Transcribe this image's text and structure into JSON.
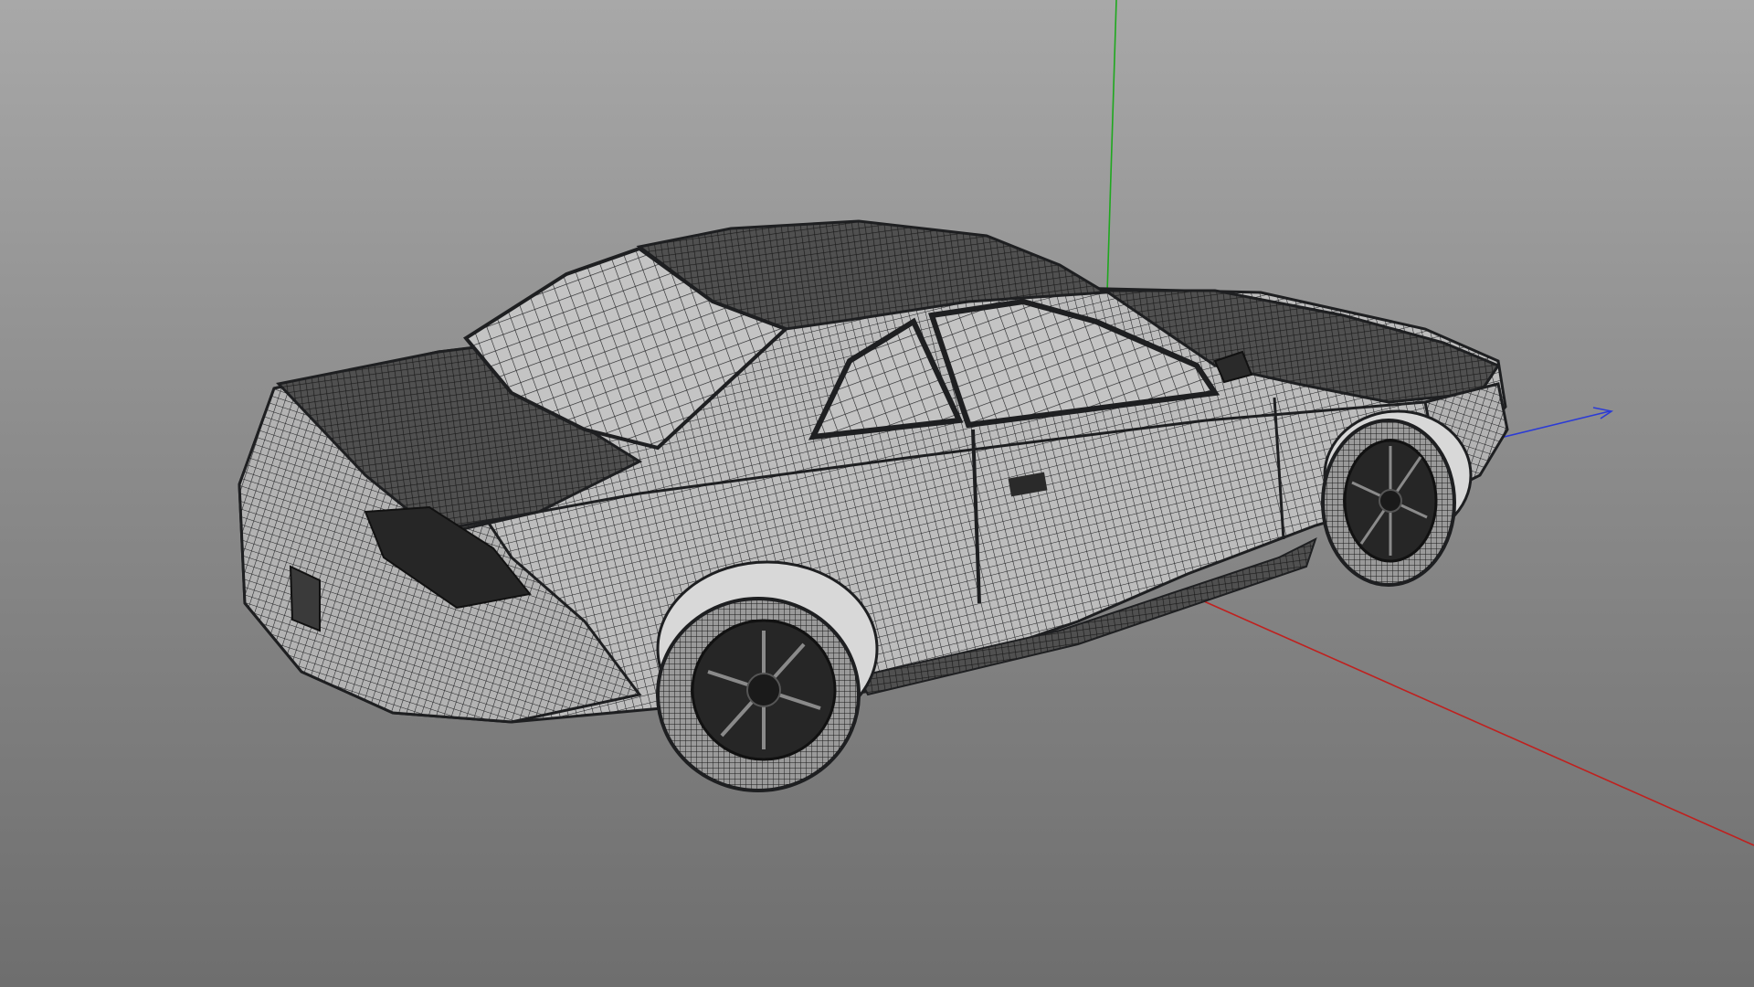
{
  "viewport": {
    "background_top": "#a8a8a8",
    "background_bottom": "#6e6e6e"
  },
  "axes": {
    "x_axis_color": "#c0201e",
    "y_axis_color": "#1fa81f",
    "z_axis_color": "#2b3bd6"
  },
  "model": {
    "render_mode": "wireframe",
    "wire_color": "#1e1f21",
    "surface_color": "#b9b9b9",
    "icon": "car-wireframe"
  }
}
